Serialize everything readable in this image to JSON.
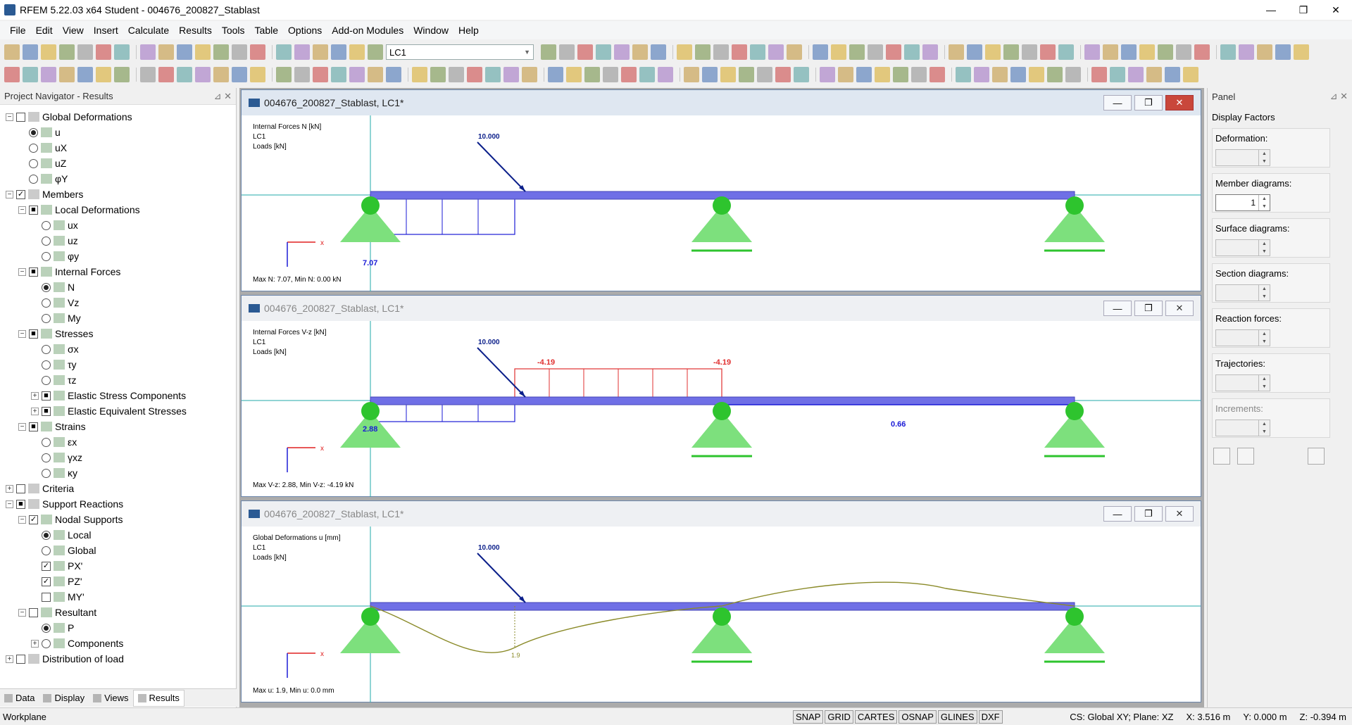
{
  "window": {
    "title": "RFEM 5.22.03 x64 Student - 004676_200827_Stablast",
    "minimize": "—",
    "maximize": "❐",
    "close": "✕"
  },
  "menu": [
    "File",
    "Edit",
    "View",
    "Insert",
    "Calculate",
    "Results",
    "Tools",
    "Table",
    "Options",
    "Add-on Modules",
    "Window",
    "Help"
  ],
  "toolbar": {
    "load_case": "LC1"
  },
  "navigator": {
    "title": "Project Navigator - Results",
    "items": [
      {
        "label": "Global Deformations",
        "level": 0,
        "exp": "−",
        "ctl": "cb",
        "state": ""
      },
      {
        "label": "u",
        "level": 1,
        "ctl": "rb",
        "state": "on"
      },
      {
        "label": "uX",
        "level": 1,
        "ctl": "rb",
        "state": ""
      },
      {
        "label": "uZ",
        "level": 1,
        "ctl": "rb",
        "state": ""
      },
      {
        "label": "φY",
        "level": 1,
        "ctl": "rb",
        "state": ""
      },
      {
        "label": "Members",
        "level": 0,
        "exp": "−",
        "ctl": "cb",
        "state": "✓"
      },
      {
        "label": "Local Deformations",
        "level": 1,
        "exp": "−",
        "ctl": "cb",
        "state": "■"
      },
      {
        "label": "ux",
        "level": 2,
        "ctl": "rb",
        "state": ""
      },
      {
        "label": "uz",
        "level": 2,
        "ctl": "rb",
        "state": ""
      },
      {
        "label": "φy",
        "level": 2,
        "ctl": "rb",
        "state": ""
      },
      {
        "label": "Internal Forces",
        "level": 1,
        "exp": "−",
        "ctl": "cb",
        "state": "■"
      },
      {
        "label": "N",
        "level": 2,
        "ctl": "rb",
        "state": "on"
      },
      {
        "label": "Vz",
        "level": 2,
        "ctl": "rb",
        "state": ""
      },
      {
        "label": "My",
        "level": 2,
        "ctl": "rb",
        "state": ""
      },
      {
        "label": "Stresses",
        "level": 1,
        "exp": "−",
        "ctl": "cb",
        "state": "■"
      },
      {
        "label": "σx",
        "level": 2,
        "ctl": "rb",
        "state": ""
      },
      {
        "label": "τy",
        "level": 2,
        "ctl": "rb",
        "state": ""
      },
      {
        "label": "τz",
        "level": 2,
        "ctl": "rb",
        "state": ""
      },
      {
        "label": "Elastic Stress Components",
        "level": 2,
        "exp": "+",
        "ctl": "cb",
        "state": "■"
      },
      {
        "label": "Elastic Equivalent Stresses",
        "level": 2,
        "exp": "+",
        "ctl": "cb",
        "state": "■"
      },
      {
        "label": "Strains",
        "level": 1,
        "exp": "−",
        "ctl": "cb",
        "state": "■"
      },
      {
        "label": "εx",
        "level": 2,
        "ctl": "rb",
        "state": ""
      },
      {
        "label": "γxz",
        "level": 2,
        "ctl": "rb",
        "state": ""
      },
      {
        "label": "κy",
        "level": 2,
        "ctl": "rb",
        "state": ""
      },
      {
        "label": "Criteria",
        "level": 0,
        "exp": "+",
        "ctl": "cb",
        "state": ""
      },
      {
        "label": "Support Reactions",
        "level": 0,
        "exp": "−",
        "ctl": "cb",
        "state": "■"
      },
      {
        "label": "Nodal Supports",
        "level": 1,
        "exp": "−",
        "ctl": "cb",
        "state": "✓"
      },
      {
        "label": "Local",
        "level": 2,
        "ctl": "rb",
        "state": "on"
      },
      {
        "label": "Global",
        "level": 2,
        "ctl": "rb",
        "state": ""
      },
      {
        "label": "PX'",
        "level": 2,
        "ctl": "cb",
        "state": "✓"
      },
      {
        "label": "PZ'",
        "level": 2,
        "ctl": "cb",
        "state": "✓"
      },
      {
        "label": "MY'",
        "level": 2,
        "ctl": "cb",
        "state": ""
      },
      {
        "label": "Resultant",
        "level": 1,
        "exp": "−",
        "ctl": "cb",
        "state": ""
      },
      {
        "label": "P",
        "level": 2,
        "ctl": "rb",
        "state": "on"
      },
      {
        "label": "Components",
        "level": 2,
        "exp": "+",
        "ctl": "rb",
        "state": ""
      },
      {
        "label": "Distribution of load",
        "level": 0,
        "exp": "+",
        "ctl": "cb",
        "state": ""
      }
    ],
    "tabs": [
      "Data",
      "Display",
      "Views",
      "Results"
    ]
  },
  "windows": [
    {
      "title": "004676_200827_Stablast, LC1*",
      "info": [
        "Internal Forces N [kN]",
        "LC1",
        "Loads [kN]"
      ],
      "status": "Max N: 7.07, Min N: 0.00 kN",
      "load": "10.000",
      "val": "7.07"
    },
    {
      "title": "004676_200827_Stablast, LC1*",
      "info": [
        "Internal Forces V-z [kN]",
        "LC1",
        "Loads [kN]"
      ],
      "status": "Max V-z: 2.88, Min V-z: -4.19 kN",
      "load": "10.000",
      "val1": "-4.19",
      "val2": "-4.19",
      "val3": "2.88",
      "val4": "0.66"
    },
    {
      "title": "004676_200827_Stablast, LC1*",
      "info": [
        "Global Deformations u [mm]",
        "LC1",
        "Loads [kN]"
      ],
      "status": "Max u: 1.9, Min u: 0.0 mm",
      "load": "10.000",
      "val": "1.9"
    }
  ],
  "panel": {
    "title": "Panel",
    "subtitle": "Display Factors",
    "groups": [
      {
        "label": "Deformation:",
        "value": "",
        "enabled": false
      },
      {
        "label": "Member diagrams:",
        "value": "1",
        "enabled": true
      },
      {
        "label": "Surface diagrams:",
        "value": "",
        "enabled": false
      },
      {
        "label": "Section diagrams:",
        "value": "",
        "enabled": false
      },
      {
        "label": "Reaction forces:",
        "value": "",
        "enabled": false
      },
      {
        "label": "Trajectories:",
        "value": "",
        "enabled": false
      },
      {
        "label": "Increments:",
        "value": "",
        "enabled": false
      }
    ]
  },
  "status": {
    "left": "Workplane",
    "buttons": [
      "SNAP",
      "GRID",
      "CARTES",
      "OSNAP",
      "GLINES",
      "DXF"
    ],
    "cs": "CS: Global XY; Plane: XZ",
    "x": "X: 3.516 m",
    "y": "Y: 0.000 m",
    "z": "Z: -0.394 m"
  },
  "colors": {
    "beam": "#6f6fe6",
    "support": "#7de07d",
    "force_n": "#1a1ad6",
    "force_v": "#e03030",
    "deform": "#8a8a28",
    "load": "#0b1f8a"
  }
}
